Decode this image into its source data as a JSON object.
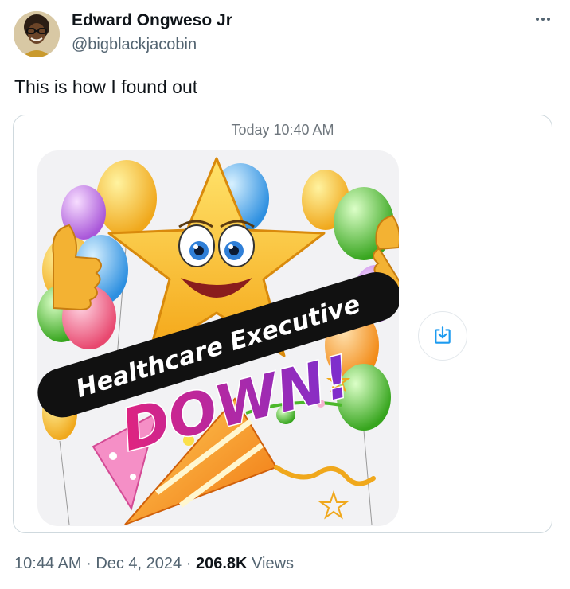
{
  "author": {
    "name": "Edward Ongweso Jr",
    "handle": "@bigblackjacobin",
    "avatar_icon": "avatar-portrait"
  },
  "more_icon": "ellipsis-icon",
  "tweet": {
    "text": "This is how I found out"
  },
  "message_card": {
    "timestamp": "Today 10:40 AM",
    "sticker": {
      "banner_text": "Healthcare Executive",
      "headline": "DOWN!"
    },
    "save_icon": "download-to-box-icon"
  },
  "meta": {
    "time": "10:44 AM",
    "separator": "·",
    "date": "Dec 4, 2024",
    "views_count": "206.8K",
    "views_label": "Views"
  },
  "colors": {
    "text_primary": "#0f1419",
    "text_secondary": "#536471",
    "border": "#cfd9de",
    "accent_blue": "#1d9bf0",
    "headline_purple": "#8e2cc9",
    "headline_magenta": "#d9238a"
  }
}
